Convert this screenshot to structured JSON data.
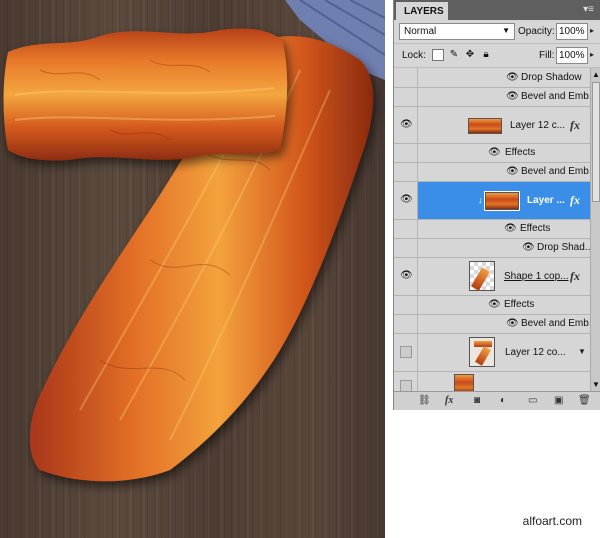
{
  "panel": {
    "tab_label": "LAYERS",
    "menu_icon": "panel-menu-icon",
    "blend_mode": "Normal",
    "opacity_label": "Opacity:",
    "opacity_value": "100%",
    "lock_label": "Lock:",
    "fill_label": "Fill:",
    "fill_value": "100%"
  },
  "layers": [
    {
      "type": "effect",
      "label": "Drop Shadow"
    },
    {
      "type": "effect",
      "label": "Bevel and Emb..."
    },
    {
      "type": "layer",
      "label": "Layer 12 c...",
      "visible": true,
      "fx": "fx"
    },
    {
      "type": "effects-header",
      "label": "Effects"
    },
    {
      "type": "effect",
      "label": "Bevel and Emb..."
    },
    {
      "type": "layer",
      "label": "Layer ...",
      "visible": true,
      "fx": "fx",
      "selected": true
    },
    {
      "type": "effects-header",
      "label": "Effects"
    },
    {
      "type": "effect",
      "label": "Drop Shad..."
    },
    {
      "type": "layer",
      "label": "Shape 1 cop...",
      "visible": true,
      "fx": "fx"
    },
    {
      "type": "effects-header",
      "label": "Effects"
    },
    {
      "type": "effect",
      "label": "Bevel and Emb..."
    },
    {
      "type": "layer",
      "label": "Layer 12 co...",
      "visible": false
    }
  ],
  "bottom_icons": [
    "link-layers-icon",
    "add-style-icon",
    "add-mask-icon",
    "adjustment-layer-icon",
    "new-group-icon",
    "new-layer-icon",
    "delete-layer-icon"
  ],
  "watermark": "alfoart.com",
  "colors": {
    "selection": "#3a8ee8",
    "panel_bg": "#d6d6d6"
  }
}
